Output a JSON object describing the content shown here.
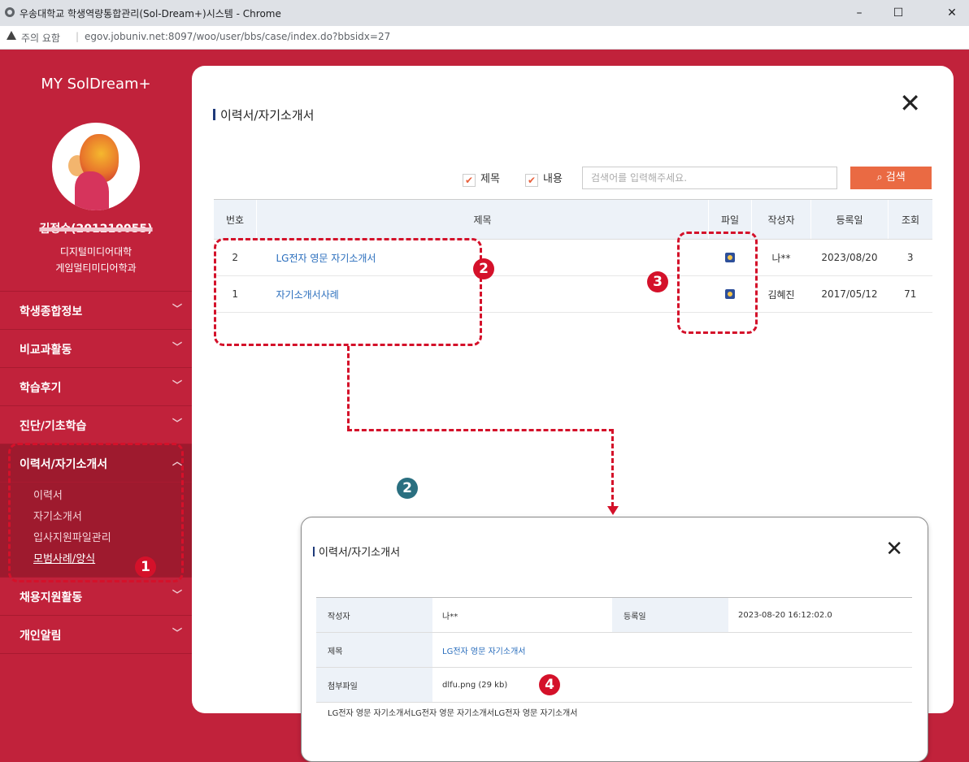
{
  "window": {
    "title": "우송대학교 학생역량통합관리(Sol-Dream+)시스템 - Chrome",
    "controls": {
      "minimize": "–",
      "maximize": "☐",
      "close": "✕"
    }
  },
  "address_bar": {
    "security_label": "주의 요함",
    "url": "egov.jobuniv.net:8097/woo/user/bbs/case/index.do?bbsidx=27"
  },
  "sidebar": {
    "brand": "MY SolDream+",
    "user_name": "김정수(201210055)",
    "college": "디지털미디어대학",
    "department": "게임멀티미디어학과",
    "menu": [
      {
        "label": "학생종합정보",
        "chevron": "﹀"
      },
      {
        "label": "비교과활동",
        "chevron": "﹀"
      },
      {
        "label": "학습후기",
        "chevron": "﹀"
      },
      {
        "label": "진단/기초학습",
        "chevron": "﹀"
      },
      {
        "label": "이력서/자기소개서",
        "chevron": "︿"
      },
      {
        "label": "채용지원활동",
        "chevron": "﹀"
      },
      {
        "label": "개인알림",
        "chevron": "﹀"
      }
    ],
    "submenu": [
      "이력서",
      "자기소개서",
      "입사지원파일관리",
      "모범사례/양식"
    ]
  },
  "panel": {
    "title": "이력서/자기소개서",
    "close": "✕",
    "filters": [
      {
        "label": "제목",
        "checked": true
      },
      {
        "label": "내용",
        "checked": true
      }
    ],
    "check_mark": "✔",
    "search_placeholder": "검색어를 입력해주세요.",
    "search_button": "⌕ 검색",
    "columns": [
      "번호",
      "제목",
      "파일",
      "작성자",
      "등록일",
      "조회"
    ],
    "rows": [
      {
        "no": "2",
        "title": "LG전자 영문 자기소개서",
        "author": "나**",
        "date": "2023/08/20",
        "views": "3"
      },
      {
        "no": "1",
        "title": "자기소개서사례",
        "author": "김혜진",
        "date": "2017/05/12",
        "views": "71"
      }
    ]
  },
  "annotations": {
    "b1": "1",
    "b2": "2",
    "b3": "3",
    "b2b": "2",
    "b4": "4"
  },
  "detail": {
    "title": "이력서/자기소개서",
    "close": "✕",
    "author_label": "작성자",
    "author": "나**",
    "date_label": "등록일",
    "date": "2023-08-20 16:12:02.0",
    "subject_label": "제목",
    "subject": "LG전자 영문 자기소개서",
    "attach_label": "첨부파일",
    "attach": "dlfu.png (29 kb)",
    "body": "LG전자 영문 자기소개서LG전자 영문 자기소개서LG전자 영문 자기소개서"
  },
  "colors": {
    "brand": "#c1223b",
    "accent": "#ea6a43",
    "link": "#2a6ebd",
    "annotation": "#d4112a",
    "annotation_alt": "#2a6f80"
  }
}
